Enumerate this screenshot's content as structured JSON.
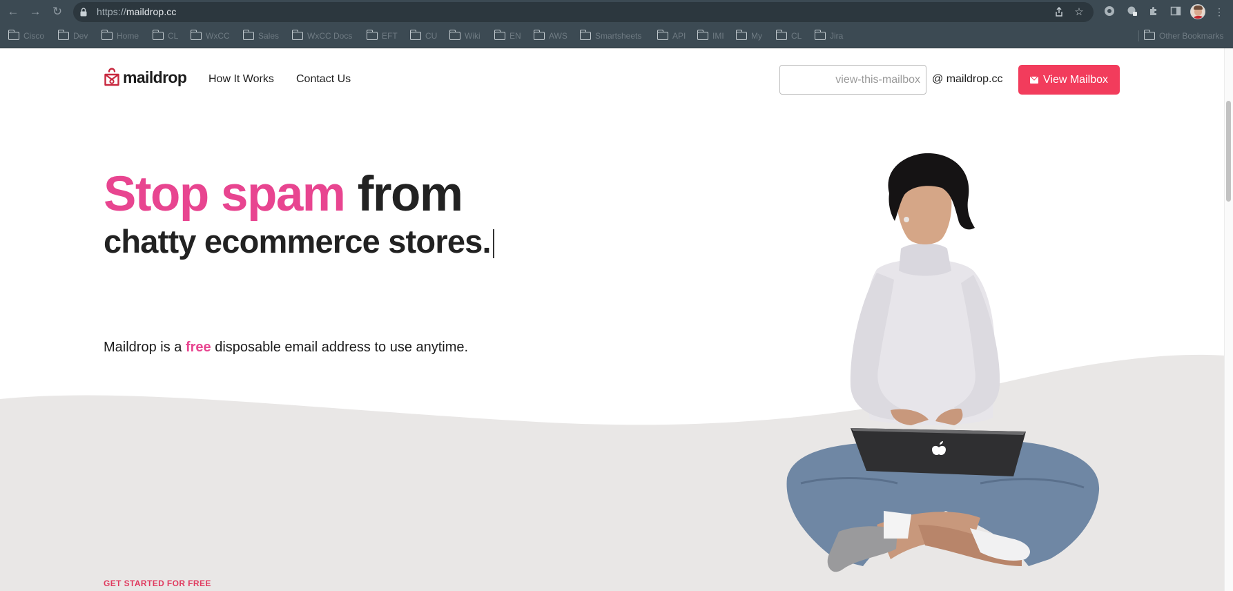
{
  "browser": {
    "url_scheme": "https://",
    "url_host": "maildrop.cc",
    "bookmarks": [
      "Cisco",
      "Dev",
      "Home",
      "CL",
      "WxCC",
      "Sales",
      "WxCC Docs",
      "EFT",
      "CU",
      "Wiki",
      "EN",
      "AWS",
      "Smartsheets",
      "API",
      "IMI",
      "My",
      "CL",
      "Jira"
    ],
    "other_bookmarks": "Other Bookmarks"
  },
  "header": {
    "logo_text": "maildrop",
    "nav": [
      "How It Works",
      "Contact Us"
    ],
    "mailbox_placeholder": "view-this-mailbox",
    "domain_suffix": "@ maildrop.cc",
    "view_button": "View Mailbox"
  },
  "hero": {
    "line1_pink": "Stop spam",
    "line1_dark": "from",
    "line2": "chatty ecommerce stores.",
    "tagline_pre": "Maildrop is a",
    "tagline_free": "free",
    "tagline_post": "disposable email address to use anytime."
  },
  "section": {
    "eyebrow": "GET STARTED FOR FREE"
  },
  "colors": {
    "accent_pink": "#e84590",
    "button_red": "#f23c5c",
    "chrome_dark": "#3c4a53",
    "wave_gray": "#e9e7e6"
  }
}
